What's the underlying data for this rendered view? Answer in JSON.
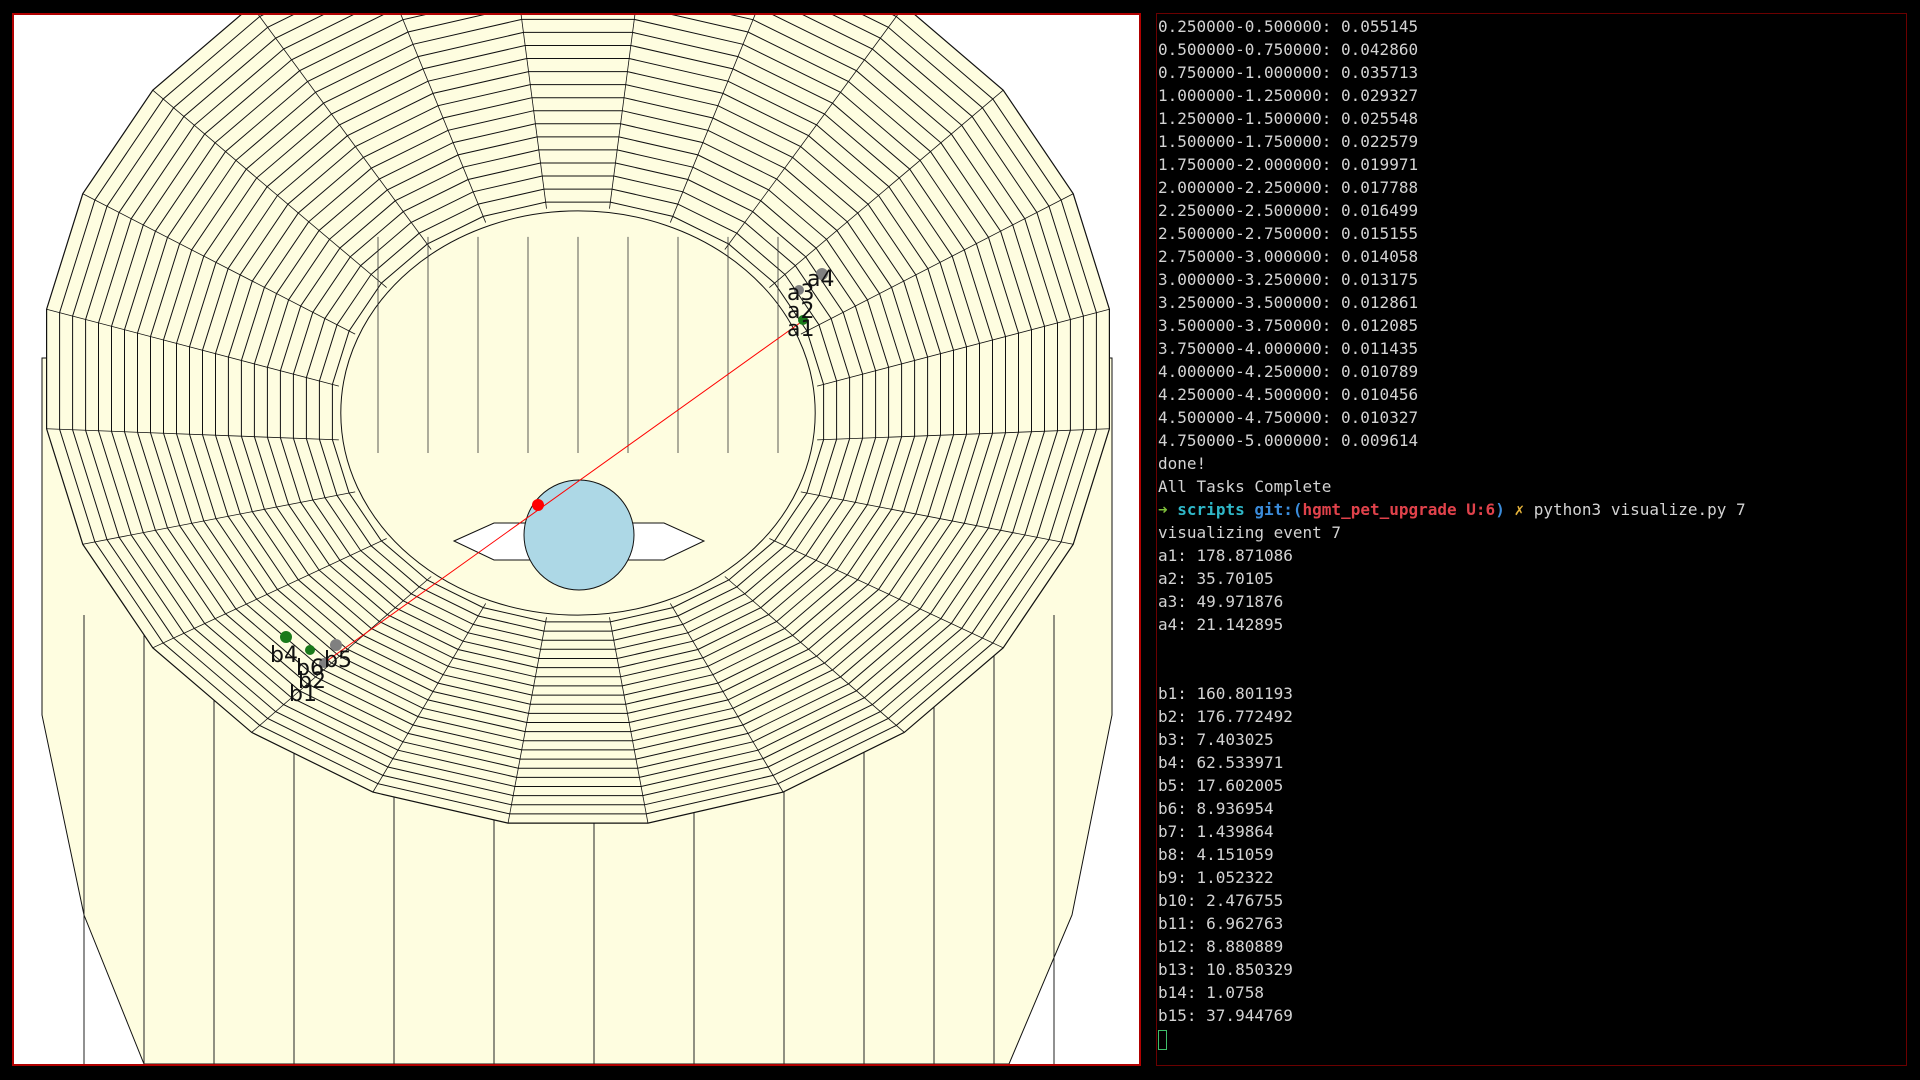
{
  "terminal": {
    "histogram_lines": [
      "0.250000-0.500000: 0.055145",
      "0.500000-0.750000: 0.042860",
      "0.750000-1.000000: 0.035713",
      "1.000000-1.250000: 0.029327",
      "1.250000-1.500000: 0.025548",
      "1.500000-1.750000: 0.022579",
      "1.750000-2.000000: 0.019971",
      "2.000000-2.250000: 0.017788",
      "2.250000-2.500000: 0.016499",
      "2.500000-2.750000: 0.015155",
      "2.750000-3.000000: 0.014058",
      "3.000000-3.250000: 0.013175",
      "3.250000-3.500000: 0.012861",
      "3.500000-3.750000: 0.012085",
      "3.750000-4.000000: 0.011435",
      "4.000000-4.250000: 0.010789",
      "4.250000-4.500000: 0.010456",
      "4.500000-4.750000: 0.010327",
      "4.750000-5.000000: 0.009614"
    ],
    "done_text": "done!",
    "complete_text": "All Tasks Complete",
    "prompt": {
      "arrow": "➜",
      "dir": "scripts",
      "git_label": "git:(",
      "branch": "hgmt_pet_upgrade U:6",
      "git_close": ")",
      "dirty": "✗",
      "command": "python3 visualize.py 7"
    },
    "event_line": "visualizing event 7",
    "a_values": [
      "a1: 178.871086",
      "a2: 35.70105",
      "a3: 49.971876",
      "a4: 21.142895"
    ],
    "b_values": [
      "b1: 160.801193",
      "b2: 176.772492",
      "b3: 7.403025",
      "b4: 62.533971",
      "b5: 17.602005",
      "b6: 8.936954",
      "b7: 1.439864",
      "b8: 4.151059",
      "b9: 1.052322",
      "b10: 2.476755",
      "b11: 6.962763",
      "b12: 8.880889",
      "b13: 10.850329",
      "b14: 1.0758",
      "b15: 37.944769"
    ]
  },
  "scene": {
    "detector_fill": "#fefde0",
    "sphere_fill": "#add8e6",
    "line_color": "#ff0000",
    "labels": {
      "a1": "a1",
      "a2": "a2",
      "a3": "a3",
      "a4": "a4",
      "b4": "b4",
      "b5": "b5",
      "b6": "b6",
      "b2": "b2",
      "b1": "b1"
    }
  }
}
